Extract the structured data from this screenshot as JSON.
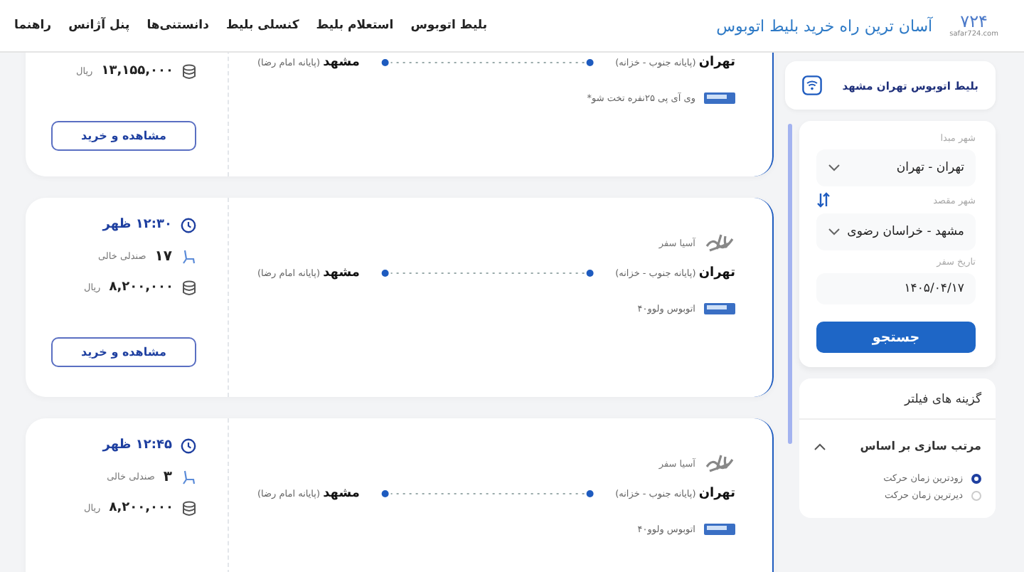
{
  "header": {
    "logo": {
      "mark": "۷۲۴",
      "domain": "safar724.com"
    },
    "tagline": "آسان ترین راه خرید بلیط اتوبوس",
    "nav": [
      "بلیط اتوبوس",
      "استعلام بلیط",
      "کنسلی بلیط",
      "دانستنی‌ها",
      "پنل آژانس",
      "راهنما"
    ]
  },
  "sidebar": {
    "route_title": "بلیط اتوبوس تهران مشهد",
    "search_form": {
      "origin_label": "شهر مبدا",
      "origin": "تهران - تهران",
      "destination_label": "شهر مقصد",
      "destination": "مشهد - خراسان رضوی",
      "date_label": "تاریخ سفر",
      "date": "۱۴۰۵/۰۴/۱۷",
      "submit": "جستجو"
    },
    "filters": {
      "title": "گزینه های فیلتر",
      "sort": {
        "title": "مرتب سازی بر اساس",
        "expanded": true,
        "options": [
          {
            "label": "زودترین زمان حرکت",
            "selected": true
          },
          {
            "label": "دیرترین زمان حرکت",
            "selected": false
          }
        ]
      }
    }
  },
  "trips": [
    {
      "price": "۱۳,۱۵۵,۰۰۰",
      "currency": "ریال",
      "button": "مشاهده و خرید",
      "origin": "تهران",
      "origin_terminal": "(پایانه جنوب - خزانه)",
      "destination": "مشهد",
      "destination_terminal": "(پایانه امام رضا)",
      "bus_type": "وی آی پی ۲۵نفره تخت شو*"
    },
    {
      "time": "۱۲:۳۰ ظهر",
      "seats": "۱۷",
      "seats_label": "صندلی خالی",
      "price": "۸,۲۰۰,۰۰۰",
      "currency": "ریال",
      "button": "مشاهده و خرید",
      "company": "آسیا سفر",
      "origin": "تهران",
      "origin_terminal": "(پایانه جنوب - خزانه)",
      "destination": "مشهد",
      "destination_terminal": "(پایانه امام رضا)",
      "bus_type": "اتوبوس ولوو۴۰"
    },
    {
      "time": "۱۲:۴۵ ظهر",
      "seats": "۳",
      "seats_label": "صندلی خالی",
      "price": "۸,۲۰۰,۰۰۰",
      "currency": "ریال",
      "company": "آسیا سفر",
      "origin": "تهران",
      "origin_terminal": "(پایانه جنوب - خزانه)",
      "destination": "مشهد",
      "destination_terminal": "(پایانه امام رضا)",
      "bus_type": "اتوبوس ولوو۴۰"
    }
  ]
}
